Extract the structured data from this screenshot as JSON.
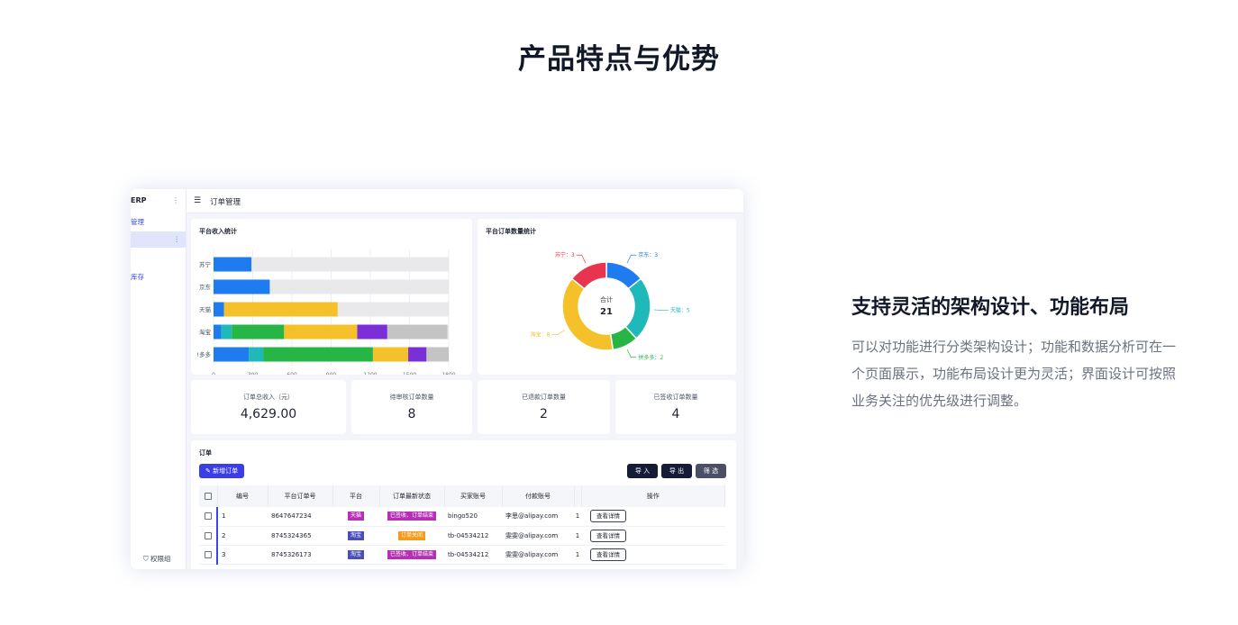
{
  "page": {
    "title": "产品特点与优势",
    "feature_title": "支持灵活的架构设计、功能布局",
    "feature_desc": "可以对功能进行分类架构设计；功能和数据分析可在一个页面展示，功能布局设计更为灵活；界面设计可按照业务关注的优先级进行调整。"
  },
  "app": {
    "sidebar": {
      "brand": "ERP",
      "items": [
        {
          "label": "管理"
        },
        {
          "label": ""
        },
        {
          "label": ""
        },
        {
          "label": "库存"
        }
      ],
      "footer": "权限组"
    },
    "topbar": {
      "breadcrumb": "订单管理"
    },
    "revenue_card": {
      "title": "平台收入统计"
    },
    "orders_card": {
      "title": "平台订单数量统计"
    },
    "stats": [
      {
        "label": "订单总收入（元）",
        "value": "4,629.00"
      },
      {
        "label": "待审核订单数量",
        "value": "8"
      },
      {
        "label": "已退款订单数量",
        "value": "2"
      },
      {
        "label": "已签收订单数量",
        "value": "4"
      }
    ],
    "orders": {
      "title": "订单",
      "new_button": "新增订单",
      "import_button": "导 入",
      "export_button": "导 出",
      "filter_button": "筛 选",
      "columns": [
        "编号",
        "平台订单号",
        "平台",
        "订单最新状态",
        "买家账号",
        "付款账号",
        "操作"
      ],
      "rows": [
        {
          "id": "1",
          "order_no": "8647647234",
          "platform": "天猫",
          "status": "已签收、订单结束",
          "buyer": "bingo520",
          "payer": "李思@alipay.com",
          "extra": "1",
          "action": "查看详情"
        },
        {
          "id": "2",
          "order_no": "8745324365",
          "platform": "淘宝",
          "status": "订单关闭",
          "buyer": "tb-04534212",
          "payer": "雯雯@alipay.com",
          "extra": "1",
          "action": "查看详情"
        },
        {
          "id": "3",
          "order_no": "8745326173",
          "platform": "淘宝",
          "status": "已签收、订单结束",
          "buyer": "tb-04534212",
          "payer": "雯雯@alipay.com",
          "extra": "1",
          "action": "查看详情"
        }
      ],
      "colors": {
        "天猫": "#b62fb5",
        "淘宝": "#4a4fb8",
        "已签收、订单结束": "#b62fb5",
        "订单关闭": "#f59a1c"
      }
    }
  },
  "chart_data": [
    {
      "type": "bar",
      "orientation": "horizontal",
      "stacked": true,
      "categories": [
        "苏宁",
        "京东",
        "天猫",
        "淘宝",
        "拼多多"
      ],
      "category_labels": [
        "苏宁",
        "京东",
        "天猫",
        "淘宝",
        "!多多"
      ],
      "xlim": [
        0,
        1800
      ],
      "xticks": [
        "0",
        "300",
        "600",
        "900",
        "1200",
        "1500",
        "1800"
      ],
      "series": [
        {
          "color": "#1f7bf0",
          "values": [
            290,
            430,
            80,
            60,
            270
          ]
        },
        {
          "color": "#20b9b9",
          "values": [
            0,
            0,
            0,
            80,
            110
          ]
        },
        {
          "color": "#27b546",
          "values": [
            0,
            0,
            0,
            400,
            840
          ]
        },
        {
          "color": "#f5c12a",
          "values": [
            0,
            0,
            870,
            560,
            270
          ]
        },
        {
          "color": "#7b2fd6",
          "values": [
            0,
            0,
            0,
            230,
            140
          ]
        },
        {
          "color": "#c4c4c4",
          "values": [
            0,
            0,
            0,
            460,
            170
          ]
        }
      ],
      "background_bar_value": 1800,
      "grid": true
    },
    {
      "type": "pie",
      "donut": true,
      "center_label": "合计",
      "center_value": "21",
      "slices": [
        {
          "label": "京东",
          "value": 3,
          "display": "京东：3",
          "color": "#1f7bf0"
        },
        {
          "label": "天猫",
          "value": 5,
          "display": "天猫：5",
          "color": "#20b9b9"
        },
        {
          "label": "拼多多",
          "value": 2,
          "display": "拼多多：2",
          "color": "#27b546"
        },
        {
          "label": "淘宝",
          "value": 8,
          "display": "淘宝：8",
          "color": "#f5c12a"
        },
        {
          "label": "苏宁",
          "value": 3,
          "display": "苏宁：3",
          "color": "#e8344e"
        }
      ]
    }
  ]
}
